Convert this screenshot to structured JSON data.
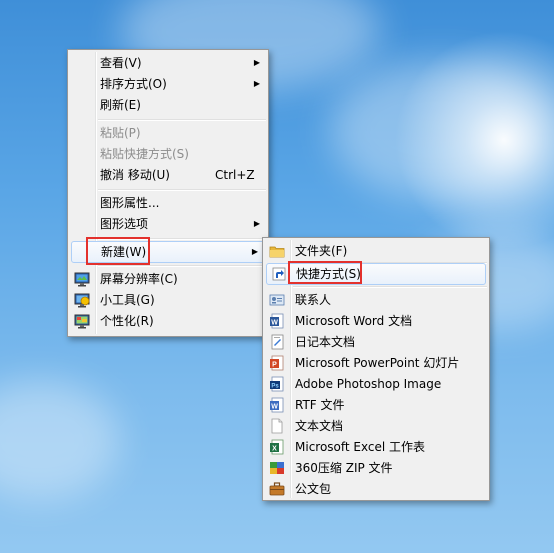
{
  "context_menu": {
    "items": [
      {
        "label": "查看(V)",
        "submenu": true
      },
      {
        "label": "排序方式(O)",
        "submenu": true
      },
      {
        "label": "刷新(E)"
      },
      {
        "label": "粘贴(P)",
        "disabled": true
      },
      {
        "label": "粘贴快捷方式(S)",
        "disabled": true
      },
      {
        "label": "撤消 移动(U)",
        "accel": "Ctrl+Z"
      },
      {
        "label": "图形属性..."
      },
      {
        "label": "图形选项",
        "submenu": true
      },
      {
        "label": "新建(W)",
        "submenu": true,
        "highlighted": true
      },
      {
        "label": "屏幕分辨率(C)",
        "icon": "monitor-icon"
      },
      {
        "label": "小工具(G)",
        "icon": "gadgets-icon"
      },
      {
        "label": "个性化(R)",
        "icon": "personalize-icon"
      }
    ]
  },
  "new_submenu": {
    "items": [
      {
        "label": "文件夹(F)",
        "icon": "folder-icon"
      },
      {
        "label": "快捷方式(S)",
        "icon": "shortcut-icon",
        "highlighted": true
      },
      {
        "label": "联系人",
        "icon": "contact-icon"
      },
      {
        "label": "Microsoft Word 文档",
        "icon": "word-icon"
      },
      {
        "label": "日记本文档",
        "icon": "journal-icon"
      },
      {
        "label": "Microsoft PowerPoint 幻灯片",
        "icon": "powerpoint-icon"
      },
      {
        "label": "Adobe Photoshop Image",
        "icon": "photoshop-icon"
      },
      {
        "label": "RTF 文件",
        "icon": "rtf-icon"
      },
      {
        "label": "文本文档",
        "icon": "text-document-icon"
      },
      {
        "label": "Microsoft Excel 工作表",
        "icon": "excel-icon"
      },
      {
        "label": "360压缩 ZIP 文件",
        "icon": "zip-icon"
      },
      {
        "label": "公文包",
        "icon": "briefcase-icon"
      }
    ]
  },
  "colors": {
    "highlight_border": "#e3312d",
    "menu_background": "#f0f0f0"
  }
}
